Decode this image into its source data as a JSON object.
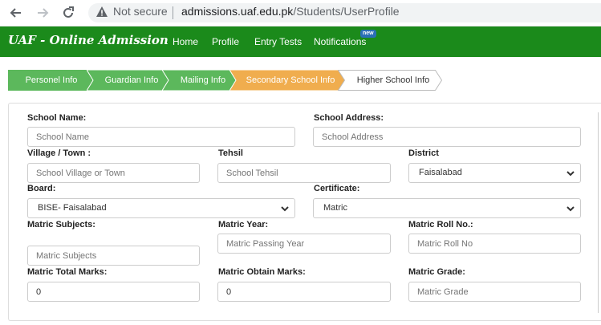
{
  "browser": {
    "security_label": "Not secure",
    "url_host": "admissions.uaf.edu.pk",
    "url_path": "/Students/UserProfile"
  },
  "nav": {
    "brand": "UAF - Online Admission",
    "items": [
      {
        "label": "Home"
      },
      {
        "label": "Profile"
      },
      {
        "label": "Entry Tests"
      },
      {
        "label": "Notifications"
      }
    ],
    "badge": "new"
  },
  "steps": [
    {
      "label": "Personel Info",
      "state": "done"
    },
    {
      "label": "Guardian Info",
      "state": "done"
    },
    {
      "label": "Mailing Info",
      "state": "done"
    },
    {
      "label": "Secondary School Info",
      "state": "active"
    },
    {
      "label": "Higher School Info",
      "state": "pending"
    }
  ],
  "colors": {
    "nav_green": "#1b8a1b",
    "step_done": "#5cb85c",
    "step_active": "#f0ad4e",
    "step_pending": "#ffffff"
  },
  "form": {
    "school_name": {
      "label": "School Name:",
      "placeholder": "School Name",
      "value": ""
    },
    "school_address": {
      "label": "School Address:",
      "placeholder": "School Address",
      "value": ""
    },
    "village": {
      "label": "Village / Town :",
      "placeholder": "School Village or Town",
      "value": ""
    },
    "tehsil": {
      "label": "Tehsil",
      "placeholder": "School Tehsil",
      "value": ""
    },
    "district": {
      "label": "District",
      "selected": "Faisalabad"
    },
    "board": {
      "label": "Board:",
      "selected": "BISE- Faisalabad"
    },
    "certificate": {
      "label": "Certificate:",
      "selected": "Matric"
    },
    "matric_subjects": {
      "label": "Matric Subjects:",
      "placeholder": "Matric Subjects",
      "value": ""
    },
    "matric_year": {
      "label": "Matric Year:",
      "placeholder": "Matric Passing Year",
      "value": ""
    },
    "matric_roll": {
      "label": "Matric Roll No.:",
      "placeholder": "Matric Roll No",
      "value": ""
    },
    "matric_total": {
      "label": "Matric Total Marks:",
      "placeholder": "",
      "value": "0"
    },
    "matric_obtain": {
      "label": "Matric Obtain Marks:",
      "placeholder": "",
      "value": "0"
    },
    "matric_grade": {
      "label": "Matric Grade:",
      "placeholder": "Matric Grade",
      "value": ""
    }
  }
}
